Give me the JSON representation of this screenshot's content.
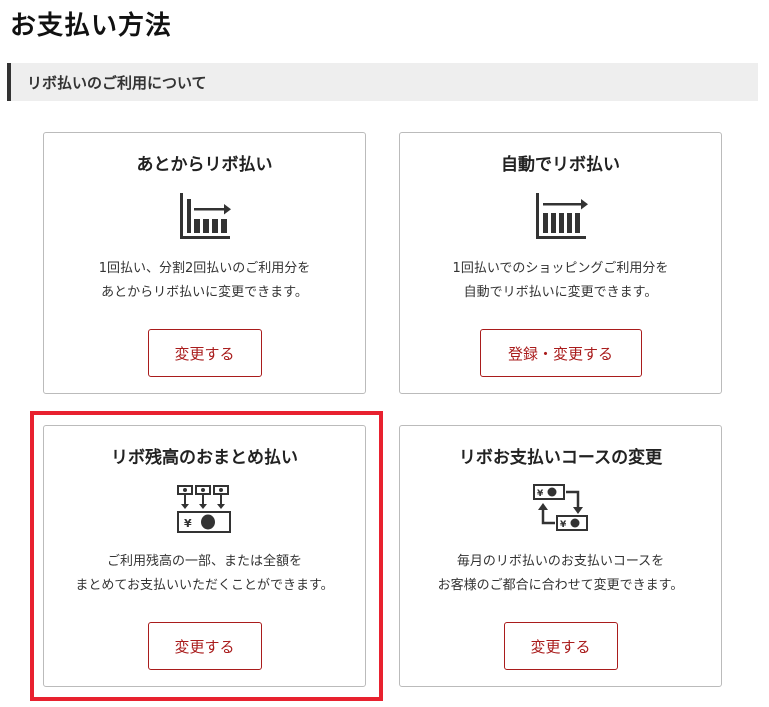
{
  "page": {
    "title": "お支払い方法"
  },
  "section": {
    "heading": "リボ払いのご利用について"
  },
  "cards": [
    {
      "title": "あとからリボ払い",
      "icon": "bar-chart-arrow-icon",
      "desc": [
        "1回払い、分割2回払いのご利用分を",
        "あとからリボ払いに変更できます。"
      ],
      "button": "変更する"
    },
    {
      "title": "自動でリボ払い",
      "icon": "bar-chart-arrow-icon",
      "desc": [
        "1回払いでのショッピングご利用分を",
        "自動でリボ払いに変更できます。"
      ],
      "button": "登録・変更する"
    },
    {
      "title": "リボ残高のおまとめ払い",
      "icon": "consolidate-payments-icon",
      "desc": [
        "ご利用残高の一部、または全額を",
        "まとめてお支払いいただくことができます。"
      ],
      "button": "変更する"
    },
    {
      "title": "リボお支払いコースの変更",
      "icon": "exchange-bills-icon",
      "desc": [
        "毎月のリボ払いのお支払いコースを",
        "お客様のご都合に合わせて変更できます。"
      ],
      "button": "変更する"
    }
  ],
  "colors": {
    "accent": "#a91c1c",
    "highlight": "#e8212f",
    "bar": "#333333"
  }
}
